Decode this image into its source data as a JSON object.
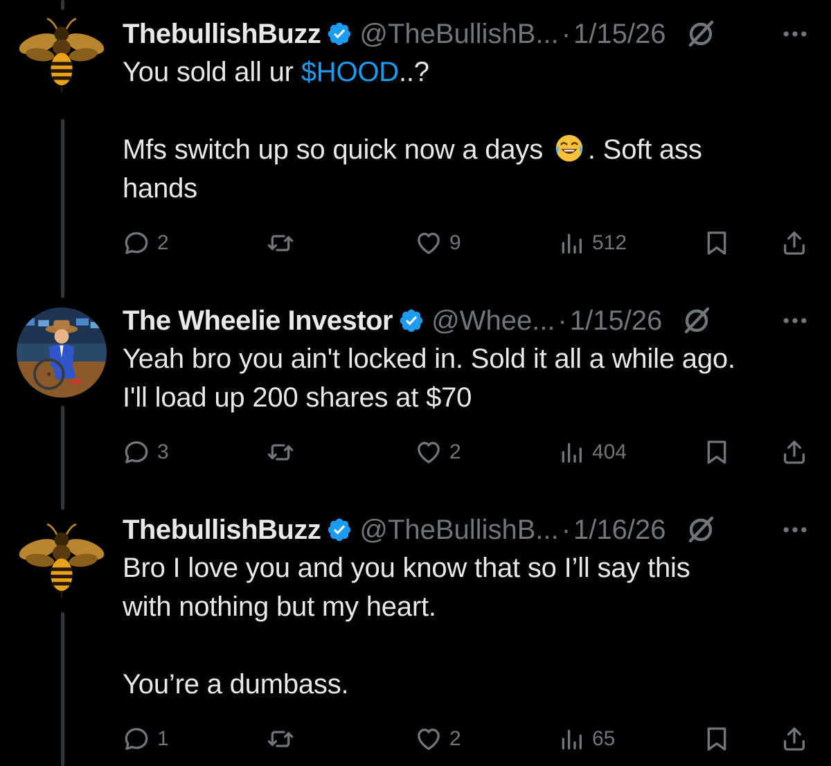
{
  "colors": {
    "background": "#000000",
    "text_primary": "#e7e9ea",
    "text_secondary": "#71767b",
    "link": "#1d9bf0",
    "verified": "#1d9bf0",
    "thread_line": "#333639"
  },
  "tweets": [
    {
      "display_name": "ThebullishBuzz",
      "handle": "@TheBullishB...",
      "separator": "·",
      "date": "1/15/26",
      "avatar_icon": "bee-avatar",
      "text_before": "You sold all ur ",
      "cashtag": "$HOOD",
      "text_after": "..?\n\nMfs switch up so quick now a days ",
      "emoji": "😂",
      "text_end": ". Soft ass\nhands",
      "replies": "2",
      "retweets": "",
      "likes": "9",
      "views": "512"
    },
    {
      "display_name": "The Wheelie Investor",
      "handle": "@Whee...",
      "separator": "·",
      "date": "1/15/26",
      "avatar_icon": "wheelie-investor-avatar",
      "text": "Yeah bro you ain't locked in. Sold it all a while ago.\nI'll load up 200 shares at $70",
      "replies": "3",
      "retweets": "",
      "likes": "2",
      "views": "404"
    },
    {
      "display_name": "ThebullishBuzz",
      "handle": "@TheBullishB...",
      "separator": "·",
      "date": "1/16/26",
      "avatar_icon": "bee-avatar",
      "text": "Bro I love you and you know that so I’ll say this\nwith nothing but my heart.\n\nYou’re a dumbass.",
      "replies": "1",
      "retweets": "",
      "likes": "2",
      "views": "65"
    }
  ]
}
